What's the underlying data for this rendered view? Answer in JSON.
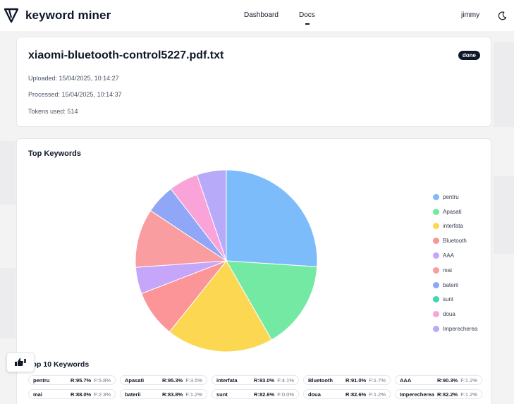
{
  "header": {
    "brand": "keyword miner",
    "nav": [
      {
        "label": "Dashboard"
      },
      {
        "label": "Docs"
      }
    ],
    "user": "jimmy"
  },
  "document": {
    "title": "xiaomi-bluetooth-control5227.pdf.txt",
    "status": "done",
    "uploaded": "Uploaded: 15/04/2025, 10:14:27",
    "processed": "Processed: 15/04/2025, 10:14:37",
    "tokens": "Tokens used: 514"
  },
  "chart_section": {
    "title": "Top Keywords"
  },
  "chart_data": {
    "type": "pie",
    "title": "Top Keywords",
    "labels": [
      "pentru",
      "Apasati",
      "interfata",
      "Bluetooth",
      "AAA",
      "mai",
      "baterii",
      "sunt",
      "doua",
      "Imperecherea"
    ],
    "values": [
      26.4,
      15.9,
      19.3,
      8.5,
      4.8,
      10.6,
      5.3,
      0,
      5.3,
      5.3
    ],
    "colors": [
      "#7dbcfb",
      "#73e9a3",
      "#fcd752",
      "#fb9597",
      "#c5a6fa",
      "#fa9da0",
      "#90a7f8",
      "#3fd5b6",
      "#f9a3d8",
      "#b7aaf9"
    ],
    "legend_position": "right"
  },
  "top10": {
    "title": "Top 10 Keywords",
    "items": [
      {
        "word": "pentru",
        "r": "R:95.7%",
        "f": "F:5.8%"
      },
      {
        "word": "Apasati",
        "r": "R:95.3%",
        "f": "F:3.5%"
      },
      {
        "word": "interfata",
        "r": "R:93.0%",
        "f": "F:4.1%"
      },
      {
        "word": "Bluetooth",
        "r": "R:91.0%",
        "f": "F:1.7%"
      },
      {
        "word": "AAA",
        "r": "R:90.3%",
        "f": "F:1.2%"
      },
      {
        "word": "mai",
        "r": "R:88.0%",
        "f": "F:2.3%"
      },
      {
        "word": "baterii",
        "r": "R:83.8%",
        "f": "F:1.2%"
      },
      {
        "word": "sunt",
        "r": "R:82.6%",
        "f": "F:0.0%"
      },
      {
        "word": "doua",
        "r": "R:82.6%",
        "f": "F:1.2%"
      },
      {
        "word": "Imperecherea",
        "r": "R:82.2%",
        "f": "F:1.2%"
      }
    ]
  },
  "icons": {
    "logo": "triangle-logo-icon",
    "theme": "moon-icon",
    "feedback": "thumbs-icon"
  }
}
